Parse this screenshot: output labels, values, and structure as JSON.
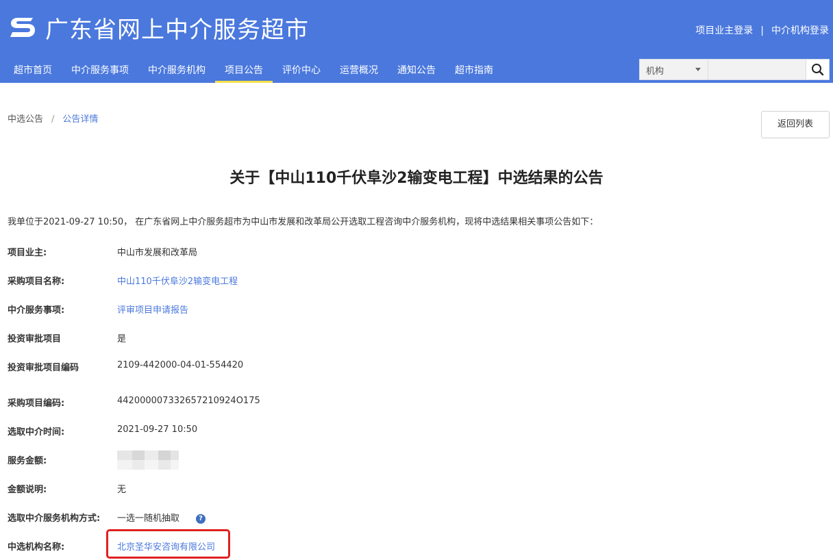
{
  "header": {
    "logo_icon": "logo-s-icon",
    "site_title": "广东省网上中介服务超市",
    "links": {
      "owner_login": "项目业主登录",
      "separator": "|",
      "agency_login": "中介机构登录"
    },
    "nav": [
      "超市首页",
      "中介服务事项",
      "中介服务机构",
      "项目公告",
      "评价中心",
      "运营概况",
      "通知公告",
      "超市指南"
    ],
    "active_nav": "项目公告",
    "search": {
      "category": "机构",
      "value": ""
    }
  },
  "breadcrumb": {
    "parent": "中选公告",
    "separator": "/",
    "current": "公告详情"
  },
  "back_button": "返回列表",
  "notice": {
    "title": "关于【中山110千伏阜沙2输变电工程】中选结果的公告",
    "intro": "我单位于2021-09-27 10:50， 在广东省网上中介服务超市为中山市发展和改革局公开选取工程咨询中介服务机构，现将中选结果相关事项公告如下：",
    "fields": [
      {
        "label": "项目业主:",
        "value": "中山市发展和改革局",
        "link": false
      },
      {
        "label": "采购项目名称:",
        "value": "中山110千伏阜沙2输变电工程",
        "link": true
      },
      {
        "label": "中介服务事项:",
        "value": "评审项目申请报告",
        "link": true
      },
      {
        "label": "投资审批项目",
        "value": "是",
        "link": false
      },
      {
        "label": "投资审批项目编码",
        "value": "2109-442000-04-01-554420",
        "link": false
      },
      {
        "label": "采购项目编码:",
        "value": "442000007332657210924O175",
        "link": false
      },
      {
        "label": "选取中介时间:",
        "value": "2021-09-27 10:50",
        "link": false
      },
      {
        "label": "服务金额:",
        "value": "",
        "link": false
      },
      {
        "label": "金额说明:",
        "value": "无",
        "link": false
      },
      {
        "label": "选取中介服务机构方式:",
        "value": "一选一随机抽取",
        "link": false
      },
      {
        "label": "中选机构名称:",
        "value": "北京圣华安咨询有限公司",
        "link": true
      }
    ],
    "help_icon": "question-circle-icon",
    "help_glyph": "?"
  },
  "colors": {
    "brand_blue": "#4a78dd",
    "active_underline": "#f5e04a",
    "highlight_red": "#e02020"
  }
}
